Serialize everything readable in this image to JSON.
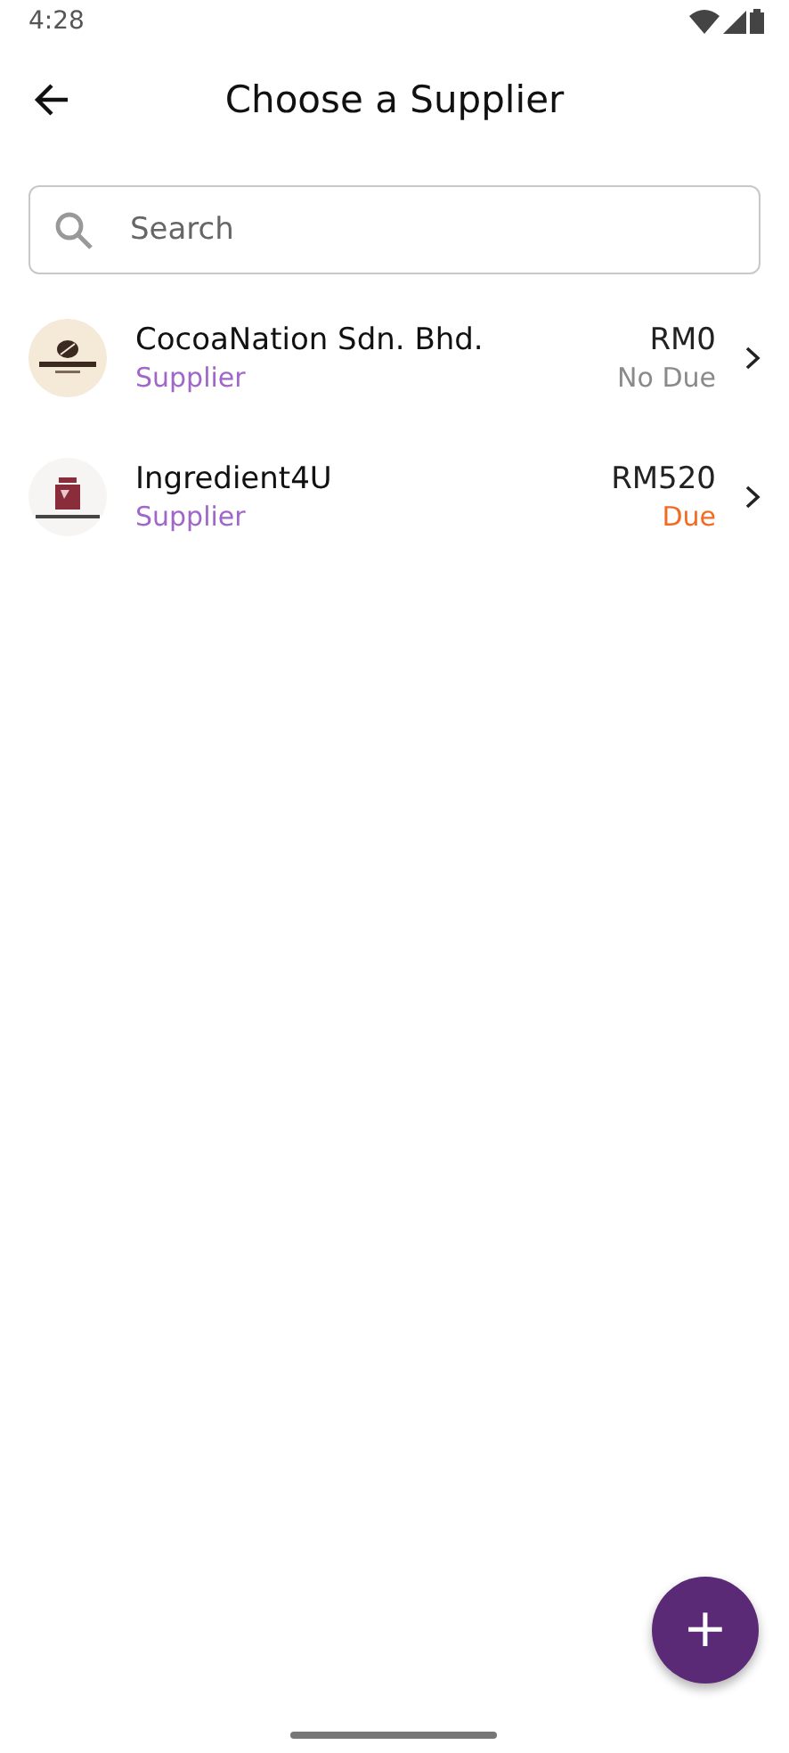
{
  "status_bar": {
    "time": "4:28"
  },
  "header": {
    "title": "Choose a Supplier"
  },
  "search": {
    "placeholder": "Search"
  },
  "suppliers": [
    {
      "name": "CocoaNation Sdn. Bhd.",
      "role": "Supplier",
      "amount": "RM0",
      "status": "No Due",
      "due": false
    },
    {
      "name": "Ingredient4U",
      "role": "Supplier",
      "amount": "RM520",
      "status": "Due",
      "due": true
    }
  ],
  "fab": {
    "label": "+"
  }
}
